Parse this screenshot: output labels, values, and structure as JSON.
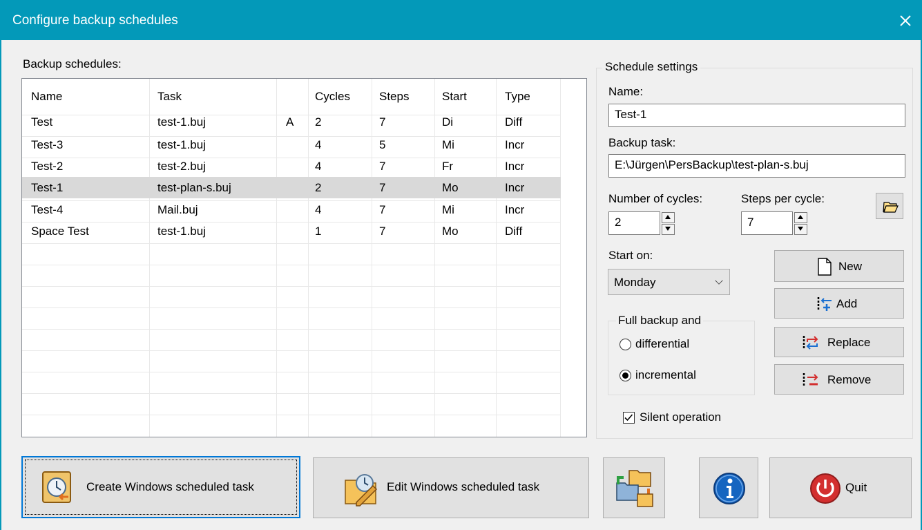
{
  "window": {
    "title": "Configure backup schedules"
  },
  "list": {
    "label": "Backup schedules:",
    "columns": [
      "Name",
      "Task",
      "",
      "Cycles",
      "Steps",
      "Start",
      "Type"
    ],
    "rows": [
      {
        "name": "Test",
        "task": "test-1.buj",
        "flag": "A",
        "cycles": "2",
        "steps": "7",
        "start": "Di",
        "type": "Diff"
      },
      {
        "name": "Test-3",
        "task": "test-1.buj",
        "flag": "",
        "cycles": "4",
        "steps": "5",
        "start": "Mi",
        "type": "Incr"
      },
      {
        "name": "Test-2",
        "task": "test-2.buj",
        "flag": "",
        "cycles": "4",
        "steps": "7",
        "start": "Fr",
        "type": "Incr"
      },
      {
        "name": "Test-1",
        "task": "test-plan-s.buj",
        "flag": "",
        "cycles": "2",
        "steps": "7",
        "start": "Mo",
        "type": "Incr"
      },
      {
        "name": "Test-4",
        "task": "Mail.buj",
        "flag": "",
        "cycles": "4",
        "steps": "7",
        "start": "Mi",
        "type": "Incr"
      },
      {
        "name": "Space Test",
        "task": "test-1.buj",
        "flag": "",
        "cycles": "1",
        "steps": "7",
        "start": "Mo",
        "type": "Diff"
      }
    ],
    "selected_row": "Test-1"
  },
  "settings": {
    "group_title": "Schedule settings",
    "name_label": "Name:",
    "name_value": "Test-1",
    "task_label": "Backup task:",
    "task_value": "E:\\Jürgen\\PersBackup\\test-plan-s.buj",
    "cycles_label": "Number of cycles:",
    "cycles_value": "2",
    "steps_label": "Steps per cycle:",
    "steps_value": "7",
    "start_label": "Start on:",
    "start_value": "Monday",
    "full_backup_label": "Full backup and",
    "radio_differential": "differential",
    "radio_incremental": "incremental",
    "mode_selected": "incremental",
    "silent_label": "Silent operation",
    "silent_checked": true,
    "buttons": {
      "new": "New",
      "add": "Add",
      "replace": "Replace",
      "remove": "Remove"
    }
  },
  "bottom": {
    "create_task": "Create Windows scheduled task",
    "edit_task": "Edit Windows scheduled task",
    "quit": "Quit"
  },
  "icons": [
    "close-icon",
    "folder-open-icon",
    "new-document-icon",
    "add-icon",
    "replace-icon",
    "remove-icon",
    "schedule-clock-icon",
    "edit-schedule-icon",
    "transfer-folders-icon",
    "info-icon",
    "power-icon"
  ],
  "colors": {
    "titlebar": "#0399b9",
    "selection": "#d9d9d9",
    "accent_blue": "#1a6fd1",
    "quit_red": "#d32f2f"
  }
}
